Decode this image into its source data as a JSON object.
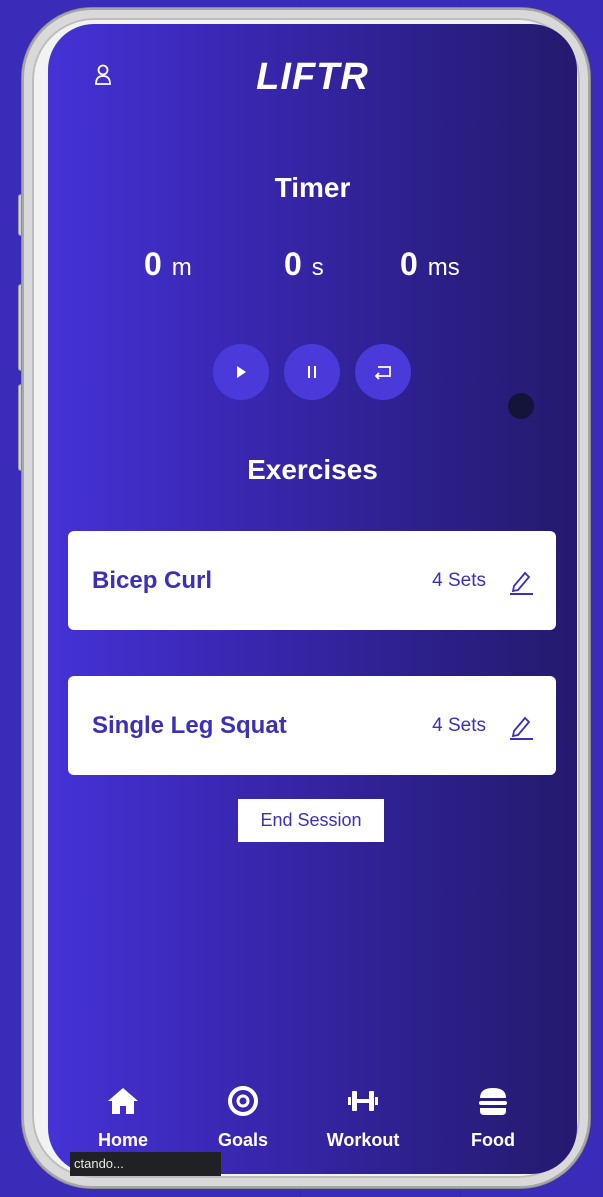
{
  "app": {
    "title": "LIFTR"
  },
  "timer": {
    "title": "Timer",
    "minutes": "0",
    "minutes_unit": "m",
    "seconds": "0",
    "seconds_unit": "s",
    "milliseconds": "0",
    "milliseconds_unit": "ms"
  },
  "controls": {
    "play_icon": "play-icon",
    "pause_icon": "pause-icon",
    "reset_icon": "reset-icon"
  },
  "exercises": {
    "title": "Exercises",
    "items": [
      {
        "name": "Bicep Curl",
        "sets": "4 Sets"
      },
      {
        "name": "Single Leg Squat",
        "sets": "4 Sets"
      }
    ]
  },
  "actions": {
    "end_session": "End Session"
  },
  "nav": {
    "items": [
      {
        "label": "Home",
        "icon": "home-icon"
      },
      {
        "label": "Goals",
        "icon": "target-icon"
      },
      {
        "label": "Workout",
        "icon": "dumbbell-icon"
      },
      {
        "label": "Food",
        "icon": "burger-icon"
      }
    ]
  },
  "status": {
    "text": "ctando..."
  },
  "colors": {
    "accent": "#3b30b6",
    "button": "#4a3ad9",
    "background": "#3a2bb8"
  }
}
